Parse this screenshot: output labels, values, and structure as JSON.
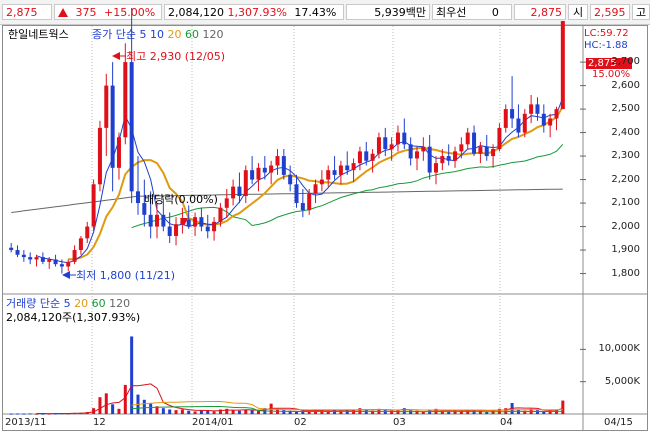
{
  "header": {
    "price": "2,875",
    "change": "375",
    "change_pct": "+15.00%",
    "volume": "2,084,120",
    "volume_ratio": "1,307.93%",
    "turnover": "17.43%",
    "amount": "5,939백만",
    "pref_label": "최우선",
    "pref_value": "0",
    "ask": "2,875",
    "open_label": "시",
    "open": "2,595",
    "high_label": "고",
    "colors": {
      "up": "#e0101a",
      "down": "#1f3fcf"
    }
  },
  "chart_data": [
    {
      "type": "candlestick",
      "title": "한일네트웍스",
      "legend": [
        "종가",
        "단순",
        "5",
        "10",
        "20",
        "60",
        "120"
      ],
      "legend_colors": [
        "#1f3fcf",
        "#1f3fcf",
        "#1f3fcf",
        "#1f3fcf",
        "#e09a10",
        "#179a3a",
        "#666666"
      ],
      "y_ticks": [
        "2,700",
        "2,600",
        "2,500",
        "2,400",
        "2,300",
        "2,200",
        "2,100",
        "2,000",
        "1,900",
        "1,800"
      ],
      "ylim": [
        1730,
        2760
      ],
      "right_labels": {
        "lc": "LC:59.72",
        "hc": "HC:-1.88",
        "price_box": "2,875",
        "pct_box": "15.00%"
      },
      "annotations": {
        "high": "최고 2,930 (12/05)",
        "low": "최저 1,800 (11/21)",
        "dividend": "배당락(0.00%)"
      },
      "ohlc": [
        [
          1910,
          1930,
          1890,
          1900
        ],
        [
          1900,
          1920,
          1870,
          1880
        ],
        [
          1880,
          1900,
          1850,
          1870
        ],
        [
          1870,
          1890,
          1840,
          1860
        ],
        [
          1860,
          1880,
          1830,
          1870
        ],
        [
          1870,
          1890,
          1840,
          1850
        ],
        [
          1850,
          1870,
          1820,
          1860
        ],
        [
          1860,
          1880,
          1830,
          1840
        ],
        [
          1840,
          1860,
          1800,
          1830
        ],
        [
          1830,
          1860,
          1810,
          1850
        ],
        [
          1850,
          1920,
          1840,
          1900
        ],
        [
          1900,
          1960,
          1880,
          1950
        ],
        [
          1950,
          2020,
          1930,
          2000
        ],
        [
          2000,
          2200,
          1980,
          2180
        ],
        [
          2180,
          2450,
          2150,
          2420
        ],
        [
          2420,
          2650,
          2300,
          2600
        ],
        [
          2600,
          2700,
          2150,
          2250
        ],
        [
          2250,
          2400,
          2200,
          2380
        ],
        [
          2380,
          2780,
          2350,
          2700
        ],
        [
          2700,
          2930,
          2100,
          2150
        ],
        [
          2150,
          2300,
          2050,
          2100
        ],
        [
          2100,
          2200,
          2000,
          2050
        ],
        [
          2050,
          2150,
          1950,
          2000
        ],
        [
          2000,
          2100,
          1950,
          2050
        ],
        [
          2050,
          2120,
          1980,
          2000
        ],
        [
          2000,
          2060,
          1930,
          1960
        ],
        [
          1960,
          2040,
          1920,
          2010
        ],
        [
          2010,
          2080,
          1970,
          2030
        ],
        [
          2030,
          2090,
          1990,
          2000
        ],
        [
          2000,
          2060,
          1960,
          2040
        ],
        [
          2040,
          2080,
          1980,
          2000
        ],
        [
          2000,
          2050,
          1950,
          1980
        ],
        [
          1980,
          2040,
          1940,
          2020
        ],
        [
          2020,
          2100,
          2000,
          2080
        ],
        [
          2080,
          2160,
          2040,
          2120
        ],
        [
          2120,
          2200,
          2090,
          2170
        ],
        [
          2170,
          2230,
          2100,
          2130
        ],
        [
          2130,
          2260,
          2100,
          2240
        ],
        [
          2240,
          2300,
          2180,
          2200
        ],
        [
          2200,
          2270,
          2150,
          2250
        ],
        [
          2250,
          2300,
          2200,
          2230
        ],
        [
          2230,
          2280,
          2180,
          2260
        ],
        [
          2260,
          2330,
          2220,
          2300
        ],
        [
          2300,
          2330,
          2200,
          2220
        ],
        [
          2220,
          2260,
          2150,
          2180
        ],
        [
          2180,
          2220,
          2080,
          2100
        ],
        [
          2100,
          2160,
          2040,
          2070
        ],
        [
          2070,
          2160,
          2050,
          2140
        ],
        [
          2140,
          2200,
          2100,
          2180
        ],
        [
          2180,
          2240,
          2150,
          2200
        ],
        [
          2200,
          2260,
          2170,
          2240
        ],
        [
          2240,
          2300,
          2200,
          2220
        ],
        [
          2220,
          2280,
          2180,
          2260
        ],
        [
          2260,
          2320,
          2220,
          2240
        ],
        [
          2240,
          2290,
          2190,
          2270
        ],
        [
          2270,
          2340,
          2240,
          2320
        ],
        [
          2320,
          2360,
          2260,
          2280
        ],
        [
          2280,
          2330,
          2230,
          2310
        ],
        [
          2310,
          2400,
          2290,
          2380
        ],
        [
          2380,
          2420,
          2300,
          2330
        ],
        [
          2330,
          2380,
          2280,
          2350
        ],
        [
          2350,
          2430,
          2320,
          2400
        ],
        [
          2400,
          2460,
          2330,
          2350
        ],
        [
          2350,
          2380,
          2260,
          2290
        ],
        [
          2290,
          2340,
          2240,
          2320
        ],
        [
          2320,
          2380,
          2280,
          2340
        ],
        [
          2340,
          2390,
          2200,
          2230
        ],
        [
          2230,
          2300,
          2180,
          2270
        ],
        [
          2270,
          2330,
          2240,
          2300
        ],
        [
          2300,
          2350,
          2260,
          2280
        ],
        [
          2280,
          2340,
          2250,
          2320
        ],
        [
          2320,
          2380,
          2290,
          2350
        ],
        [
          2350,
          2420,
          2330,
          2400
        ],
        [
          2400,
          2430,
          2300,
          2310
        ],
        [
          2310,
          2360,
          2270,
          2340
        ],
        [
          2340,
          2390,
          2280,
          2300
        ],
        [
          2300,
          2350,
          2250,
          2330
        ],
        [
          2330,
          2440,
          2320,
          2420
        ],
        [
          2420,
          2520,
          2400,
          2500
        ],
        [
          2500,
          2640,
          2420,
          2460
        ],
        [
          2460,
          2520,
          2380,
          2400
        ],
        [
          2400,
          2500,
          2380,
          2480
        ],
        [
          2480,
          2560,
          2440,
          2520
        ],
        [
          2520,
          2550,
          2450,
          2480
        ],
        [
          2480,
          2520,
          2400,
          2430
        ],
        [
          2430,
          2480,
          2380,
          2460
        ],
        [
          2460,
          2510,
          2410,
          2500
        ],
        [
          2500,
          2600,
          2580,
          2875
        ]
      ],
      "x_ticks": [
        "2013/11",
        "12",
        "2014/01",
        "02",
        "03",
        "04",
        "04/15"
      ]
    },
    {
      "type": "bar",
      "title": "거래량",
      "legend": [
        "단순",
        "5",
        "20",
        "60",
        "120"
      ],
      "legend_colors": [
        "#1f3fcf",
        "#e0101a",
        "#e09a10",
        "#179a3a",
        "#666666"
      ],
      "subtitle": "2,084,120주(1,307.93%)",
      "y_ticks": [
        "10,000K",
        "5,000K"
      ],
      "ylim": [
        0,
        13000
      ],
      "values": [
        60,
        80,
        70,
        90,
        50,
        60,
        70,
        80,
        120,
        90,
        150,
        200,
        300,
        900,
        2600,
        3200,
        1500,
        800,
        4500,
        12000,
        3000,
        2200,
        1600,
        1200,
        900,
        700,
        600,
        700,
        500,
        400,
        600,
        500,
        400,
        700,
        800,
        600,
        500,
        700,
        600,
        500,
        900,
        1600,
        800,
        600,
        500,
        400,
        600,
        500,
        700,
        600,
        500,
        600,
        500,
        700,
        600,
        900,
        700,
        500,
        800,
        600,
        500,
        700,
        900,
        600,
        500,
        400,
        600,
        800,
        500,
        400,
        600,
        500,
        700,
        600,
        500,
        400,
        600,
        800,
        900,
        1700,
        700,
        500,
        800,
        600,
        400,
        500,
        700,
        2080
      ]
    }
  ]
}
